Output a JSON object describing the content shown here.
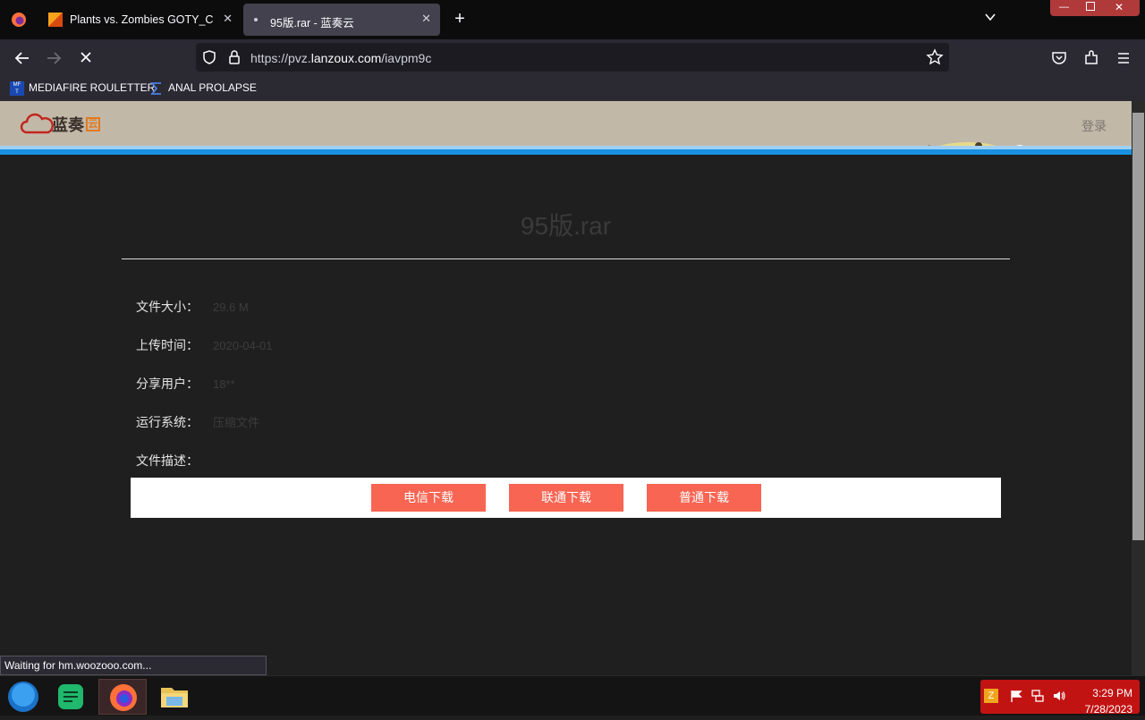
{
  "browser": {
    "tabs": [
      {
        "title": "Plants vs. Zombies GOTY_CHS.exe",
        "active": false
      },
      {
        "title": "95版.rar - 蓝奏云",
        "active": true
      }
    ],
    "new_tab": "+",
    "url_prefix": "https://pvz.",
    "url_host": "lanzoux.com",
    "url_path": "/iavpm9c",
    "bookmarks": [
      {
        "label": "MEDIAFIRE ROULETTER",
        "icon": "mediafire-icon"
      },
      {
        "label": "ANAL PROLAPSE",
        "icon": "sigma-icon"
      }
    ],
    "status": "Waiting for hm.woozooo.com..."
  },
  "site": {
    "logo_text": "蓝奏",
    "logo_badge": "云",
    "login": "登录",
    "accent": "#1991e0"
  },
  "file": {
    "name": "95版.rar",
    "info": [
      {
        "label": "文件大小：",
        "value": "29.6 M"
      },
      {
        "label": "上传时间：",
        "value": "2020-04-01"
      },
      {
        "label": "分享用户：",
        "value": "18**"
      },
      {
        "label": "运行系统：",
        "value": "压缩文件"
      },
      {
        "label": "文件描述：",
        "value": ""
      }
    ],
    "buttons": [
      "电信下载",
      "联通下载",
      "普通下载"
    ],
    "button_color": "#f86553"
  },
  "taskbar": {
    "items": [
      "start-orb-icon",
      "notes-icon",
      "firefox-icon",
      "file-explorer-icon"
    ],
    "time": "3:29 PM",
    "date": "7/28/2023"
  }
}
